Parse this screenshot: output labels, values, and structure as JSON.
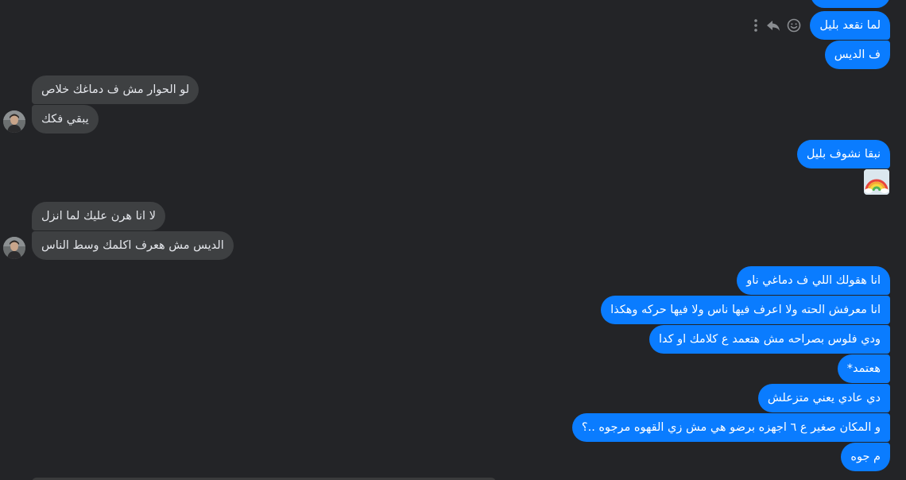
{
  "colors": {
    "background": "#232427",
    "outgoing_bubble": "#0a7cff",
    "incoming_bubble": "#3e4042",
    "icon": "#8a8d91"
  },
  "message_actions": {
    "icons": [
      "more-options-icon",
      "reply-icon",
      "react-icon"
    ]
  },
  "messages": [
    {
      "id": "m1",
      "side": "outgoing",
      "text": "لما نقعد بليل"
    },
    {
      "id": "m2",
      "side": "outgoing",
      "text": "ف الديس"
    },
    {
      "id": "m3",
      "side": "incoming",
      "text": "لو الحوار مش ف دماغك خلاص"
    },
    {
      "id": "m4",
      "side": "incoming",
      "text": "يبقي فكك"
    },
    {
      "id": "m5",
      "side": "outgoing",
      "text": "نبقا نشوف بليل"
    },
    {
      "id": "m6",
      "side": "outgoing",
      "type": "emoji",
      "icon": "rainbow-emoji-icon"
    },
    {
      "id": "m7",
      "side": "incoming",
      "text": "لا انا هرن عليك لما انزل"
    },
    {
      "id": "m8",
      "side": "incoming",
      "text": "الديس مش هعرف اكلمك وسط الناس"
    },
    {
      "id": "m9",
      "side": "outgoing",
      "text": "انا هقولك اللي ف دماغي ناو"
    },
    {
      "id": "m10",
      "side": "outgoing",
      "text": "انا معرفش الحته ولا اعرف فيها ناس ولا فيها حركه وهكذا"
    },
    {
      "id": "m11",
      "side": "outgoing",
      "text": "ودي فلوس بصراحه مش هتعمد ع كلامك او كدا"
    },
    {
      "id": "m12",
      "side": "outgoing",
      "text": "هعتمد*"
    },
    {
      "id": "m13",
      "side": "outgoing",
      "text": "دي عادي يعني متزعلش"
    },
    {
      "id": "m14",
      "side": "outgoing",
      "text": "و المكان صغير ع ٦ اجهزه برضو هي مش زي القهوه مرجوه ..؟"
    },
    {
      "id": "m15",
      "side": "outgoing",
      "text": "م جوه"
    }
  ]
}
